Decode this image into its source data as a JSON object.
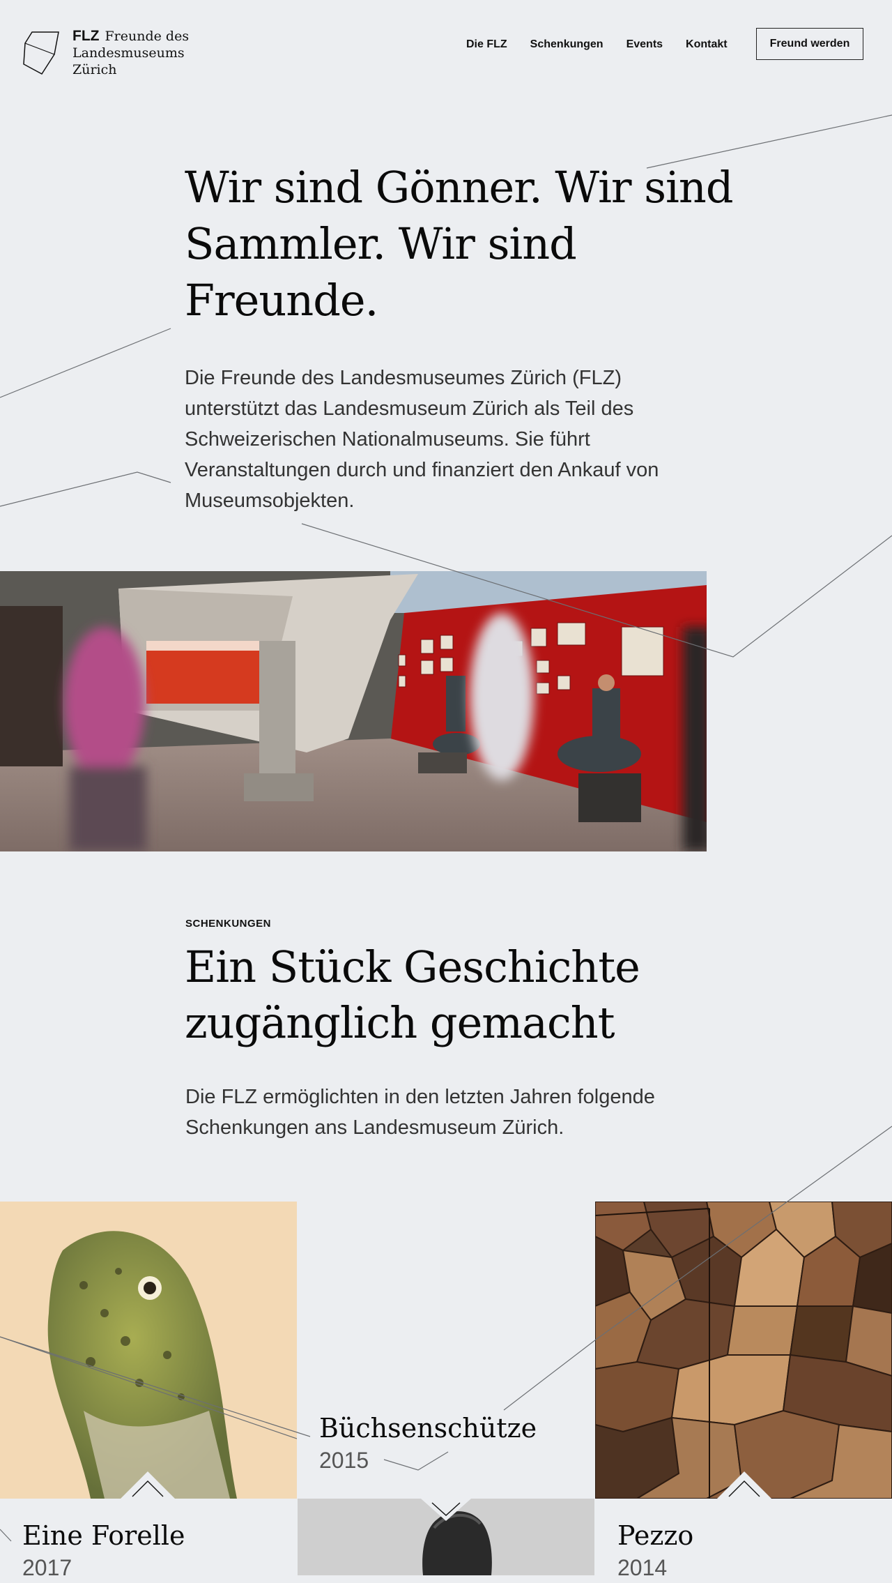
{
  "header": {
    "logo_abbr": "FLZ",
    "logo_name": "Freunde des Landesmuseums Zürich",
    "nav": [
      "Die FLZ",
      "Schenkungen",
      "Events",
      "Kontakt"
    ],
    "cta": "Freund werden"
  },
  "hero": {
    "title": "Wir sind Gönner. Wir sind Sammler. Wir sind Freunde.",
    "lead": "Die Freunde des Landesmuseumes Zürich (FLZ) unterstützt das Landesmuseum Zürich als Teil des Schweizerischen Nationalmuseums. Sie führt Veranstaltungen durch und finanziert den Ankauf von Museumsobjekten."
  },
  "schenkungen": {
    "eyebrow": "SCHENKUNGEN",
    "title": "Ein Stück Geschichte zugänglich gemacht",
    "lead": "Die FLZ ermöglichten in den letzten Jahren folgende Schenkungen ans Landesmuseum Zürich.",
    "items": [
      {
        "name": "Eine Forelle",
        "year": "2017"
      },
      {
        "name": "Büchsenschütze",
        "year": "2015"
      },
      {
        "name": "Pezzo",
        "year": "2014"
      }
    ]
  },
  "colors": {
    "background": "#eceef1",
    "text": "#0a0a0a",
    "museum_red": "#b41414"
  }
}
